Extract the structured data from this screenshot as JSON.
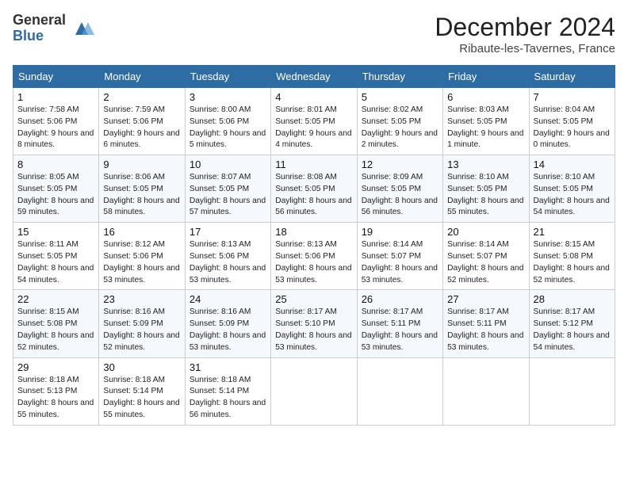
{
  "header": {
    "logo_general": "General",
    "logo_blue": "Blue",
    "month_title": "December 2024",
    "location": "Ribaute-les-Tavernes, France"
  },
  "weekdays": [
    "Sunday",
    "Monday",
    "Tuesday",
    "Wednesday",
    "Thursday",
    "Friday",
    "Saturday"
  ],
  "weeks": [
    [
      {
        "day": "1",
        "sunrise": "7:58 AM",
        "sunset": "5:06 PM",
        "daylight": "9 hours and 8 minutes."
      },
      {
        "day": "2",
        "sunrise": "7:59 AM",
        "sunset": "5:06 PM",
        "daylight": "9 hours and 6 minutes."
      },
      {
        "day": "3",
        "sunrise": "8:00 AM",
        "sunset": "5:06 PM",
        "daylight": "9 hours and 5 minutes."
      },
      {
        "day": "4",
        "sunrise": "8:01 AM",
        "sunset": "5:05 PM",
        "daylight": "9 hours and 4 minutes."
      },
      {
        "day": "5",
        "sunrise": "8:02 AM",
        "sunset": "5:05 PM",
        "daylight": "9 hours and 2 minutes."
      },
      {
        "day": "6",
        "sunrise": "8:03 AM",
        "sunset": "5:05 PM",
        "daylight": "9 hours and 1 minute."
      },
      {
        "day": "7",
        "sunrise": "8:04 AM",
        "sunset": "5:05 PM",
        "daylight": "9 hours and 0 minutes."
      }
    ],
    [
      {
        "day": "8",
        "sunrise": "8:05 AM",
        "sunset": "5:05 PM",
        "daylight": "8 hours and 59 minutes."
      },
      {
        "day": "9",
        "sunrise": "8:06 AM",
        "sunset": "5:05 PM",
        "daylight": "8 hours and 58 minutes."
      },
      {
        "day": "10",
        "sunrise": "8:07 AM",
        "sunset": "5:05 PM",
        "daylight": "8 hours and 57 minutes."
      },
      {
        "day": "11",
        "sunrise": "8:08 AM",
        "sunset": "5:05 PM",
        "daylight": "8 hours and 56 minutes."
      },
      {
        "day": "12",
        "sunrise": "8:09 AM",
        "sunset": "5:05 PM",
        "daylight": "8 hours and 56 minutes."
      },
      {
        "day": "13",
        "sunrise": "8:10 AM",
        "sunset": "5:05 PM",
        "daylight": "8 hours and 55 minutes."
      },
      {
        "day": "14",
        "sunrise": "8:10 AM",
        "sunset": "5:05 PM",
        "daylight": "8 hours and 54 minutes."
      }
    ],
    [
      {
        "day": "15",
        "sunrise": "8:11 AM",
        "sunset": "5:05 PM",
        "daylight": "8 hours and 54 minutes."
      },
      {
        "day": "16",
        "sunrise": "8:12 AM",
        "sunset": "5:06 PM",
        "daylight": "8 hours and 53 minutes."
      },
      {
        "day": "17",
        "sunrise": "8:13 AM",
        "sunset": "5:06 PM",
        "daylight": "8 hours and 53 minutes."
      },
      {
        "day": "18",
        "sunrise": "8:13 AM",
        "sunset": "5:06 PM",
        "daylight": "8 hours and 53 minutes."
      },
      {
        "day": "19",
        "sunrise": "8:14 AM",
        "sunset": "5:07 PM",
        "daylight": "8 hours and 53 minutes."
      },
      {
        "day": "20",
        "sunrise": "8:14 AM",
        "sunset": "5:07 PM",
        "daylight": "8 hours and 52 minutes."
      },
      {
        "day": "21",
        "sunrise": "8:15 AM",
        "sunset": "5:08 PM",
        "daylight": "8 hours and 52 minutes."
      }
    ],
    [
      {
        "day": "22",
        "sunrise": "8:15 AM",
        "sunset": "5:08 PM",
        "daylight": "8 hours and 52 minutes."
      },
      {
        "day": "23",
        "sunrise": "8:16 AM",
        "sunset": "5:09 PM",
        "daylight": "8 hours and 52 minutes."
      },
      {
        "day": "24",
        "sunrise": "8:16 AM",
        "sunset": "5:09 PM",
        "daylight": "8 hours and 53 minutes."
      },
      {
        "day": "25",
        "sunrise": "8:17 AM",
        "sunset": "5:10 PM",
        "daylight": "8 hours and 53 minutes."
      },
      {
        "day": "26",
        "sunrise": "8:17 AM",
        "sunset": "5:11 PM",
        "daylight": "8 hours and 53 minutes."
      },
      {
        "day": "27",
        "sunrise": "8:17 AM",
        "sunset": "5:11 PM",
        "daylight": "8 hours and 53 minutes."
      },
      {
        "day": "28",
        "sunrise": "8:17 AM",
        "sunset": "5:12 PM",
        "daylight": "8 hours and 54 minutes."
      }
    ],
    [
      {
        "day": "29",
        "sunrise": "8:18 AM",
        "sunset": "5:13 PM",
        "daylight": "8 hours and 55 minutes."
      },
      {
        "day": "30",
        "sunrise": "8:18 AM",
        "sunset": "5:14 PM",
        "daylight": "8 hours and 55 minutes."
      },
      {
        "day": "31",
        "sunrise": "8:18 AM",
        "sunset": "5:14 PM",
        "daylight": "8 hours and 56 minutes."
      },
      null,
      null,
      null,
      null
    ]
  ]
}
